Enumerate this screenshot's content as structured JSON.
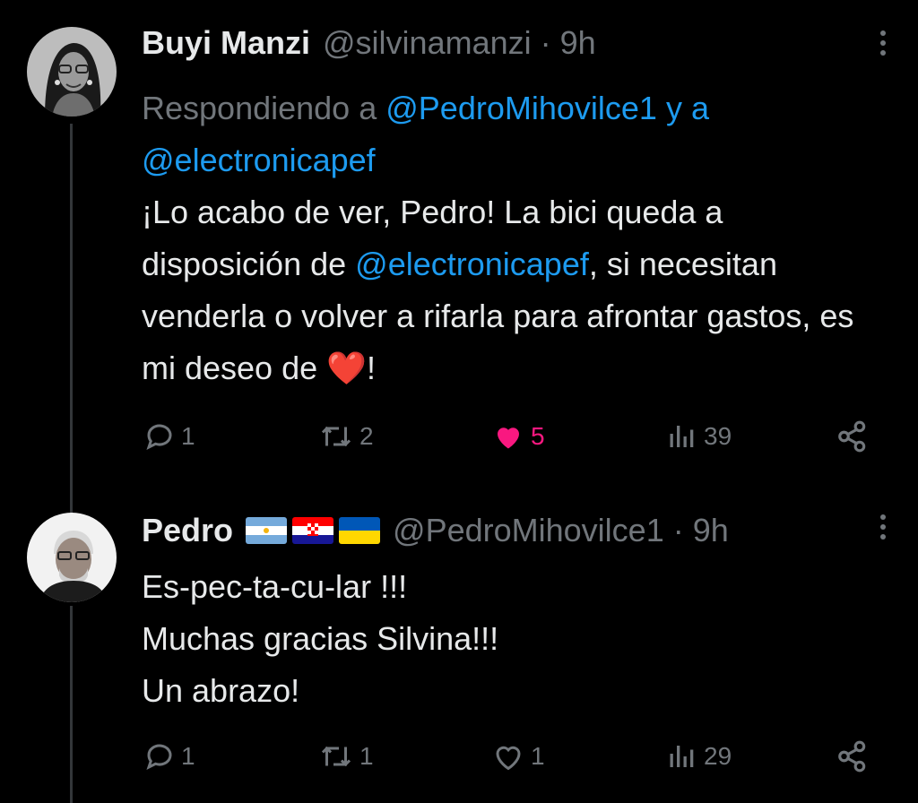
{
  "tweet1": {
    "name": "Buyi Manzi",
    "handle": "@silvinamanzi",
    "dot": "·",
    "time": "9h",
    "replying_prefix": "Respondiendo a",
    "replying_user1": "@PedroMihovilce1",
    "replying_and": "y a",
    "replying_user2": "@electronicapef",
    "text_part1": "¡Lo acabo de ver, Pedro! La bici queda a disposición de",
    "text_mention": "@electronicapef",
    "text_part2": ", si necesitan venderla o volver a rifarla para afrontar gastos, es mi deseo de",
    "text_emoji": "❤️",
    "text_end": "!",
    "replies": "1",
    "retweets": "2",
    "likes": "5",
    "views": "39",
    "liked": true
  },
  "tweet2": {
    "name": "Pedro",
    "flags": [
      "argentina",
      "croatia",
      "ukraine"
    ],
    "handle": "@PedroMihovilce1",
    "dot": "·",
    "time": "9h",
    "line1": "Es-pec-ta-cu-lar !!!",
    "line2": "Muchas gracias Silvina!!!",
    "line3": "Un abrazo!",
    "replies": "1",
    "retweets": "1",
    "likes": "1",
    "views": "29",
    "liked": false
  },
  "colors": {
    "background": "#000000",
    "text": "#e7e9ea",
    "muted": "#71767b",
    "link": "#1d9bf0",
    "like": "#f91880"
  },
  "icons": [
    "reply-icon",
    "retweet-icon",
    "like-icon",
    "views-icon",
    "share-icon",
    "more-icon"
  ]
}
